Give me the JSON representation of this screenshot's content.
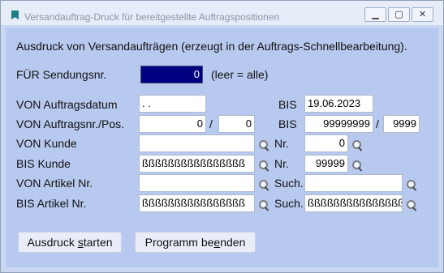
{
  "window": {
    "title": "Versandauftrag-Druck für bereitgestellte Auftragspositionen",
    "minimize_glyph": "▁",
    "maximize_glyph": "▢",
    "close_glyph": "✕"
  },
  "description": "Ausdruck von Versandaufträgen (erzeugt in der Auftrags-Schnellbearbeitung).",
  "shipment": {
    "label": "FÜR Sendungsnr.",
    "value": "0",
    "hint": "(leer = alle)"
  },
  "order_date": {
    "from_label": "VON Auftragsdatum",
    "from_value": " .  .",
    "to_label": "BIS",
    "to_value": "19.06.2023"
  },
  "order_number": {
    "from_label": "VON Auftragsnr./Pos.",
    "from_number": "0",
    "separator": "/",
    "from_position": "0",
    "to_label": "BIS",
    "to_number": "99999999",
    "to_separator": "/",
    "to_position": "9999"
  },
  "customer": {
    "from_label": "VON Kunde",
    "from_value": "",
    "from_nr_label": "Nr.",
    "from_nr_value": "0",
    "to_label": "BIS Kunde",
    "to_value": "ßßßßßßßßßßßßßßßß",
    "to_nr_label": "Nr.",
    "to_nr_value": "99999"
  },
  "article": {
    "from_label": "VON Artikel Nr.",
    "from_value": "",
    "from_search_label": "Such.",
    "from_search_value": "",
    "to_label": "BIS Artikel Nr.",
    "to_value": "ßßßßßßßßßßßßßßßß",
    "to_search_label": "Such.",
    "to_search_value": "ßßßßßßßßßßßßßßßß"
  },
  "buttons": {
    "print_prefix": "Ausdruck ",
    "print_underlined": "s",
    "print_suffix": "tarten",
    "exit_prefix": "Programm be",
    "exit_underlined": "e",
    "exit_suffix": "nden"
  },
  "icons": {
    "app": "bookmark-icon",
    "search": "magnifier-icon"
  }
}
